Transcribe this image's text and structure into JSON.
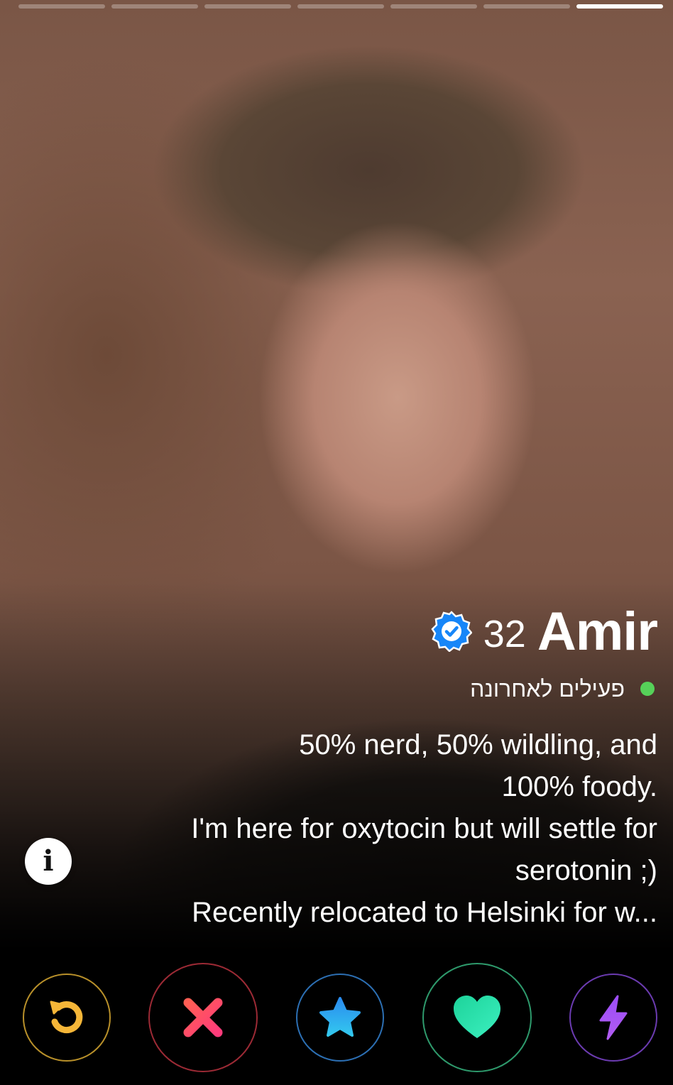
{
  "profile": {
    "name": "Amir",
    "age": "32",
    "verified": true,
    "status": "פעילים לאחרונה",
    "bio_lines": [
      "50% nerd, 50% wildling, and",
      "100% foody.",
      "I'm here for oxytocin but will settle for",
      "serotonin ;)",
      "Recently relocated to Helsinki for w..."
    ]
  },
  "photos": {
    "count": 7,
    "current_index": 6
  },
  "info_button": {
    "glyph": "i",
    "icon": "info-icon"
  },
  "actions": [
    {
      "id": "rewind",
      "icon": "rewind-icon",
      "color": "#F5B638"
    },
    {
      "id": "nope",
      "icon": "close-icon",
      "color": "#FF4A6B"
    },
    {
      "id": "super-like",
      "icon": "star-icon",
      "color": "#2DB2F0"
    },
    {
      "id": "like",
      "icon": "heart-icon",
      "color": "#2EE8A9"
    },
    {
      "id": "boost",
      "icon": "lightning-icon",
      "color": "#A150F5"
    }
  ],
  "colors": {
    "verified": "#1786F8",
    "online_dot": "#56D159"
  }
}
